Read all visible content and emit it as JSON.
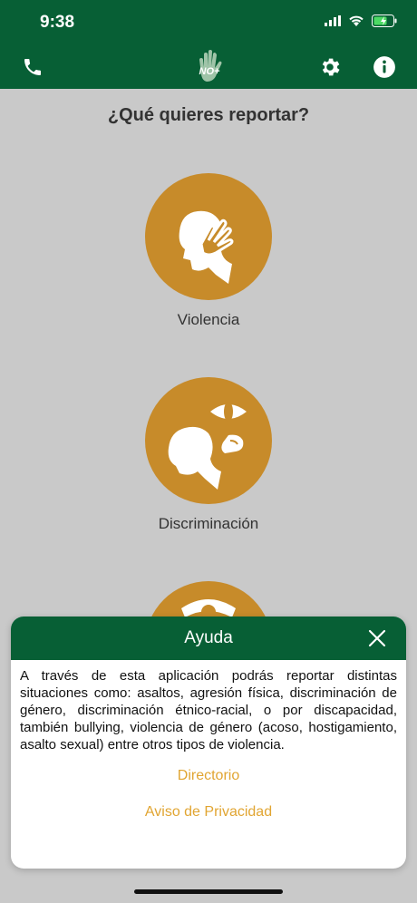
{
  "status_bar": {
    "time": "9:38"
  },
  "header": {
    "phone_icon": "phone-icon",
    "logo_icon": "hand-logo-icon",
    "logo_text": "NO+",
    "settings_icon": "gear-icon",
    "info_icon": "info-icon"
  },
  "main": {
    "question": "¿Qué quieres reportar?",
    "options": [
      {
        "label": "Violencia",
        "icon": "violence-icon"
      },
      {
        "label": "Discriminación",
        "icon": "discrimination-icon"
      },
      {
        "label": "",
        "icon": "third-option-icon"
      }
    ]
  },
  "modal": {
    "title": "Ayuda",
    "close_icon": "close-icon",
    "body": "A través de esta aplicación podrás reportar distintas situaciones como: asaltos, agresión física, discriminación de género, discriminación étnico-racial, o por discapacidad, también bullying, violencia de género (acoso, hostigamiento, asalto sexual) entre otros tipos de violencia.",
    "links": [
      "Directorio",
      "Aviso de Privacidad"
    ]
  },
  "colors": {
    "brand_green": "#075f35",
    "accent_gold": "#c78b2a",
    "link_gold": "#e1a532"
  }
}
